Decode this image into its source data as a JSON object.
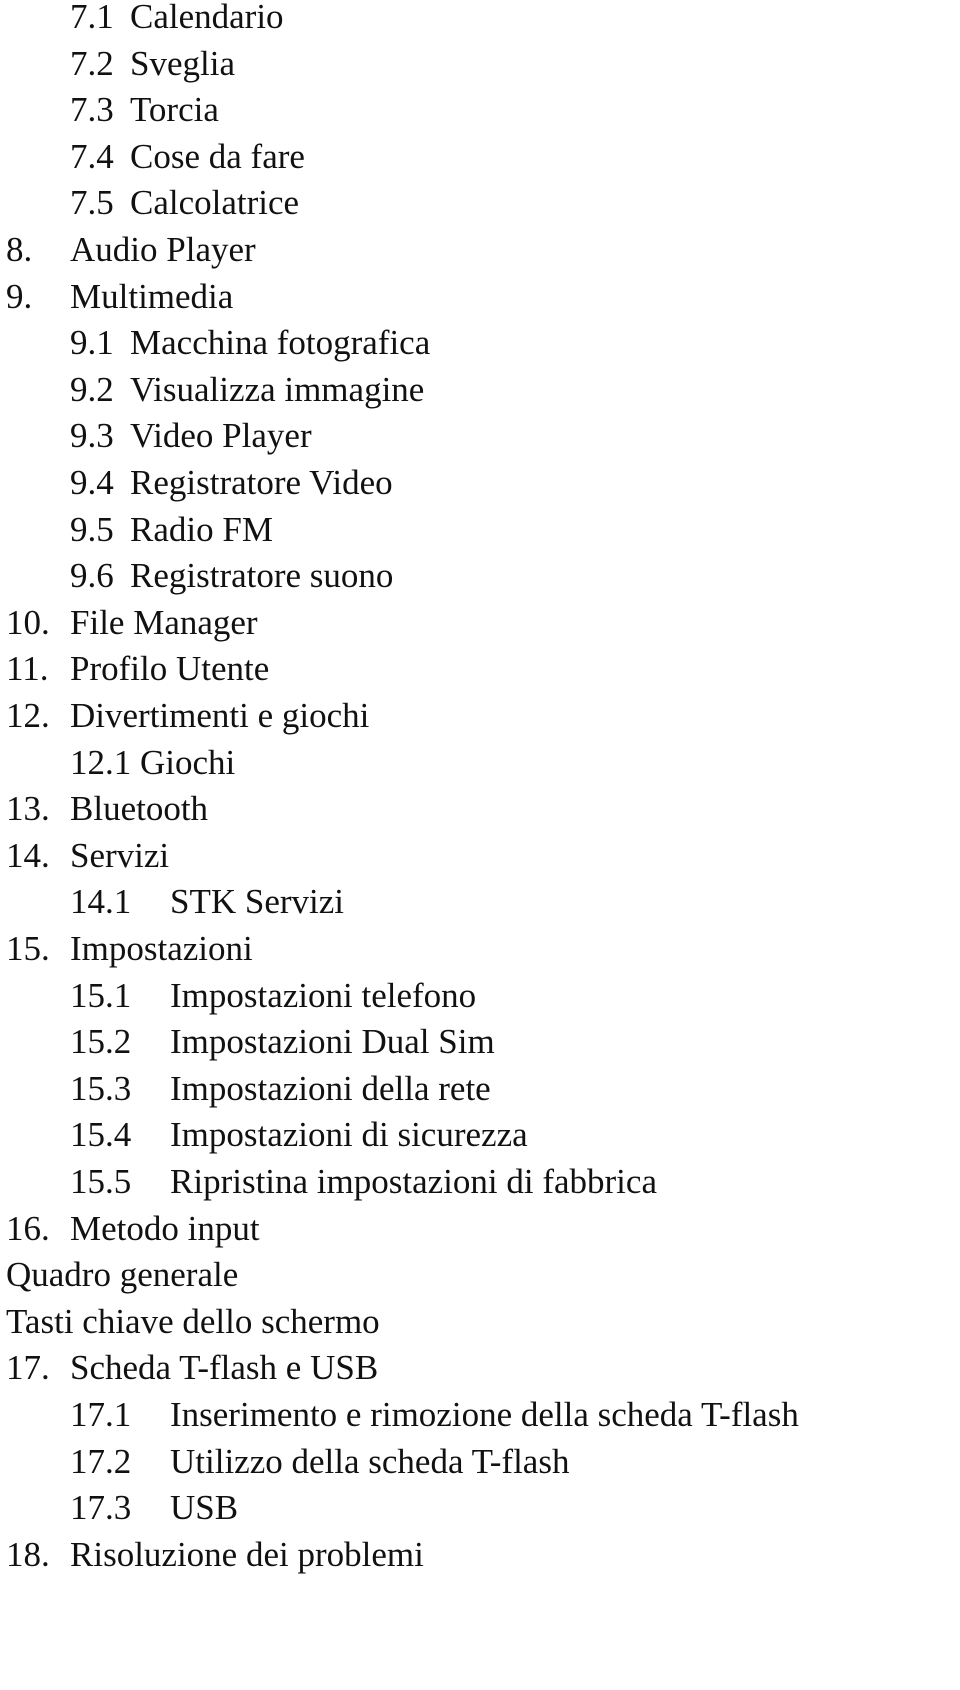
{
  "document": {
    "type": "table-of-contents",
    "entries": [
      {
        "num": "7.1",
        "text": "Calendario",
        "level": 1,
        "style": "tight"
      },
      {
        "num": "7.2",
        "text": "Sveglia",
        "level": 1,
        "style": "tight"
      },
      {
        "num": "7.3",
        "text": "Torcia",
        "level": 1,
        "style": "tight"
      },
      {
        "num": "7.4",
        "text": "Cose da fare",
        "level": 1,
        "style": "tight"
      },
      {
        "num": "7.5",
        "text": "Calcolatrice",
        "level": 1,
        "style": "tight"
      },
      {
        "num": "8.",
        "text": "Audio Player",
        "level": 0
      },
      {
        "num": "9.",
        "text": "Multimedia",
        "level": 0
      },
      {
        "num": "9.1",
        "text": "Macchina fotografica",
        "level": 1,
        "style": "tight"
      },
      {
        "num": "9.2",
        "text": "Visualizza immagine",
        "level": 1,
        "style": "tight"
      },
      {
        "num": "9.3",
        "text": "Video Player",
        "level": 1,
        "style": "tight"
      },
      {
        "num": "9.4",
        "text": "Registratore Video",
        "level": 1,
        "style": "tight"
      },
      {
        "num": "9.5",
        "text": "Radio FM",
        "level": 1,
        "style": "tight"
      },
      {
        "num": "9.6",
        "text": "Registratore suono",
        "level": 1,
        "style": "tight"
      },
      {
        "num": "10.",
        "text": "File Manager",
        "level": 0
      },
      {
        "num": "11.",
        "text": "Profilo Utente",
        "level": 0
      },
      {
        "num": "12.",
        "text": "Divertimenti e giochi",
        "level": 0
      },
      {
        "num": "12.1",
        "text": "Giochi",
        "level": 1,
        "style": "normal"
      },
      {
        "num": "13.",
        "text": "Bluetooth",
        "level": 0
      },
      {
        "num": "14.",
        "text": "Servizi",
        "level": 0
      },
      {
        "num": "14.1",
        "text": "STK Servizi",
        "level": 1,
        "style": "wide"
      },
      {
        "num": "15.",
        "text": "Impostazioni",
        "level": 0
      },
      {
        "num": "15.1",
        "text": "Impostazioni telefono",
        "level": 1,
        "style": "wide"
      },
      {
        "num": "15.2",
        "text": "Impostazioni Dual Sim",
        "level": 1,
        "style": "wide"
      },
      {
        "num": "15.3",
        "text": "Impostazioni della rete",
        "level": 1,
        "style": "wide"
      },
      {
        "num": "15.4",
        "text": "Impostazioni di sicurezza",
        "level": 1,
        "style": "wide"
      },
      {
        "num": "15.5",
        "text": "Ripristina impostazioni di fabbrica",
        "level": 1,
        "style": "wide"
      },
      {
        "num": "16.",
        "text": "Metodo input",
        "level": 0
      },
      {
        "num": "",
        "text": "Quadro generale",
        "level": "h"
      },
      {
        "num": "",
        "text": "Tasti chiave dello schermo",
        "level": "h"
      },
      {
        "num": "17.",
        "text": "Scheda T-flash e USB",
        "level": 0
      },
      {
        "num": "17.1",
        "text": "Inserimento e rimozione della scheda T-flash",
        "level": 1,
        "style": "wide"
      },
      {
        "num": "17.2",
        "text": "Utilizzo della scheda T-flash",
        "level": 1,
        "style": "wide"
      },
      {
        "num": "17.3",
        "text": "USB",
        "level": 1,
        "style": "wide"
      },
      {
        "num": "18.",
        "text": "Risoluzione dei problemi",
        "level": 0
      }
    ]
  }
}
